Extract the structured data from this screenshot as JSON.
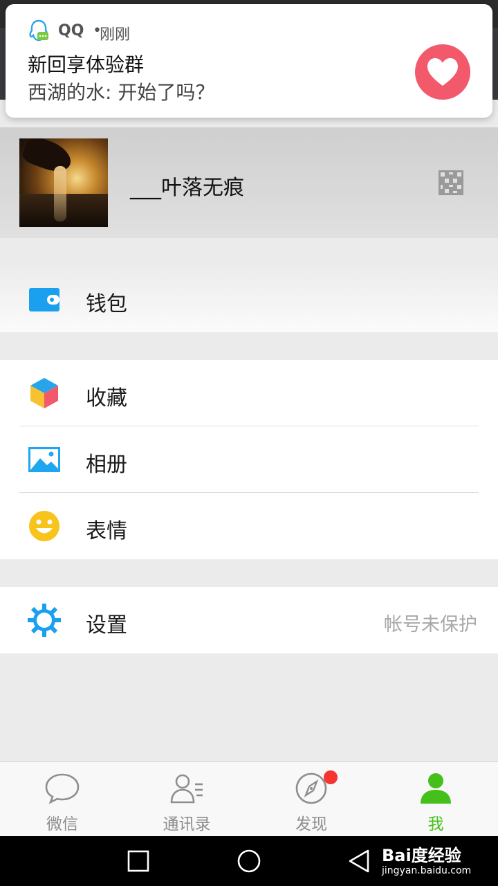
{
  "notification": {
    "app_name": "QQ",
    "separator": "•",
    "time": "刚刚",
    "title": "新回享体验群",
    "message": "西湖的水: 开始了吗？",
    "heart_color": "#f2596b"
  },
  "profile": {
    "name": "___叶落无痕"
  },
  "menu": {
    "wallet": "钱包",
    "favorites": "收藏",
    "album": "相册",
    "stickers": "表情",
    "settings": "设置",
    "settings_status": "帐号未保护"
  },
  "tabs": [
    {
      "label": "微信",
      "icon": "chat-icon"
    },
    {
      "label": "通讯录",
      "icon": "contacts-icon"
    },
    {
      "label": "发现",
      "icon": "compass-icon"
    },
    {
      "label": "我",
      "icon": "person-icon"
    }
  ],
  "active_tab": "我",
  "colors": {
    "accent_green": "#45c01a",
    "badge_red": "#f43530",
    "icon_blue": "#1aa0ee"
  },
  "watermark": {
    "main": "Bai度经验",
    "sub": "jingyan.baidu.com"
  }
}
